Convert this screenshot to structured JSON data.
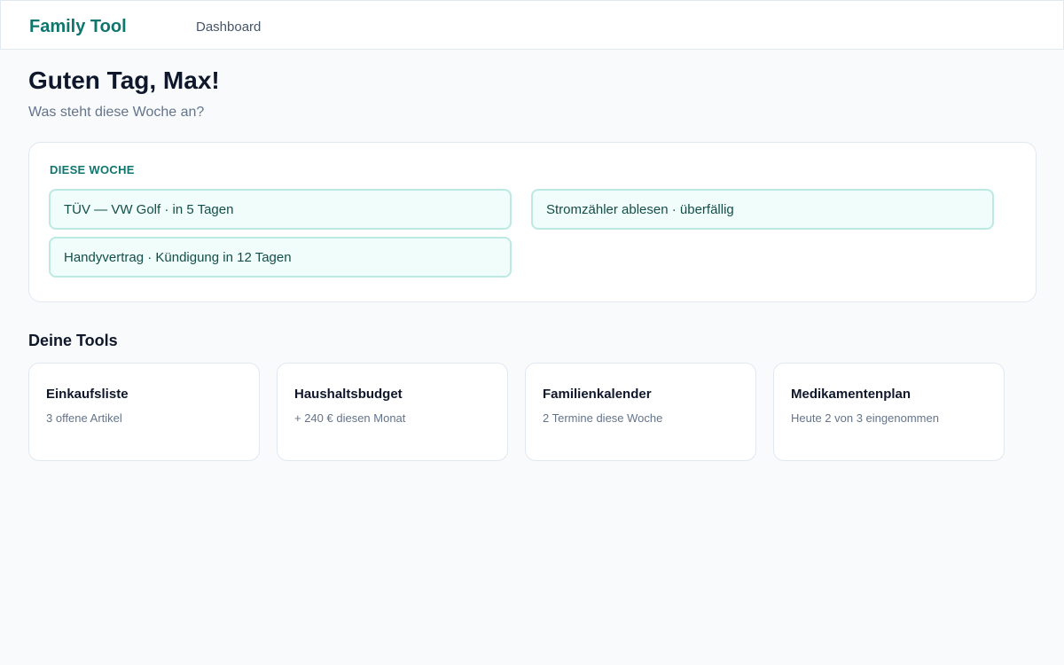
{
  "header": {
    "brand": "Family Tool",
    "nav": [
      "Dashboard"
    ]
  },
  "greeting": {
    "title": "Guten Tag, Max!",
    "subtitle": "Was steht diese Woche an?"
  },
  "this_week": {
    "heading": "DIESE WOCHE",
    "items": [
      "TÜV — VW Golf · in 5 Tagen",
      "Stromzähler ablesen · überfällig",
      "Handyvertrag · Kündigung in 12 Tagen"
    ]
  },
  "tools": {
    "heading": "Deine Tools",
    "cards": [
      {
        "title": "Einkaufsliste",
        "description": "3 offene Artikel"
      },
      {
        "title": "Haushaltsbudget",
        "description": "+ 240 € diesen Monat"
      },
      {
        "title": "Familienkalender",
        "description": "2 Termine diese Woche"
      },
      {
        "title": "Medikamentenplan",
        "description": "Heute 2 von 3 eingenommen"
      }
    ]
  },
  "colors": {
    "accent": "#0f766e",
    "background": "#f8fafc",
    "chip_background": "#f0fdfa",
    "chip_border": "#bde9e3"
  }
}
